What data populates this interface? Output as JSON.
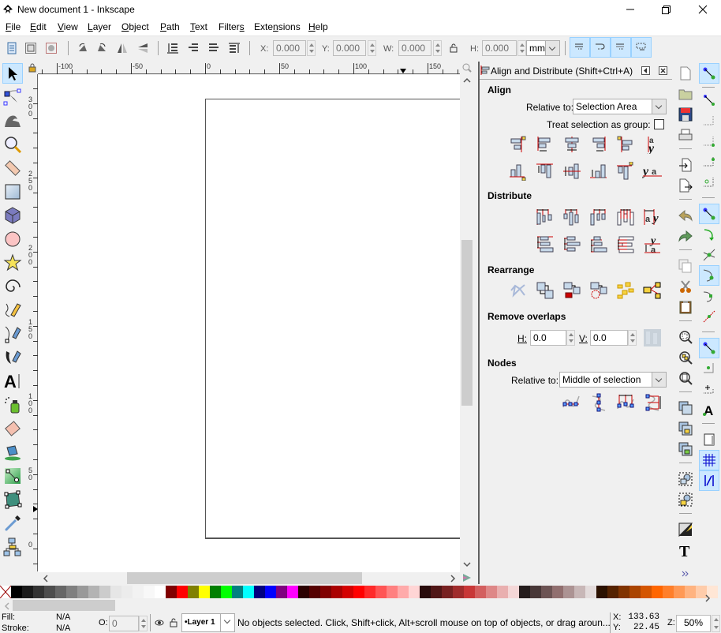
{
  "window": {
    "title": "New document 1 - Inkscape",
    "controls": [
      "minimize",
      "restore",
      "close"
    ]
  },
  "menu": [
    {
      "label": "File",
      "accel": "F"
    },
    {
      "label": "Edit",
      "accel": "E"
    },
    {
      "label": "View",
      "accel": "V"
    },
    {
      "label": "Layer",
      "accel": "L"
    },
    {
      "label": "Object",
      "accel": "O"
    },
    {
      "label": "Path",
      "accel": "P"
    },
    {
      "label": "Text",
      "accel": "T"
    },
    {
      "label": "Filters",
      "accel": "s"
    },
    {
      "label": "Extensions",
      "accel": "n"
    },
    {
      "label": "Help",
      "accel": "H"
    }
  ],
  "toolbar": {
    "x_label": "X:",
    "x_value": "0.000",
    "y_label": "Y:",
    "y_value": "0.000",
    "w_label": "W:",
    "w_value": "0.000",
    "h_label": "H:",
    "h_value": "0.000",
    "unit": "mm"
  },
  "rulers": {
    "horizontal": [
      "-100",
      "-50",
      "0",
      "50",
      "100",
      "150"
    ],
    "vertical": [
      "300",
      "250",
      "200",
      "150",
      "100",
      "50",
      "0"
    ]
  },
  "tools": [
    "selector",
    "node",
    "tweak",
    "zoom",
    "measure",
    "rectangle",
    "3d-box",
    "ellipse",
    "star",
    "spiral",
    "pencil",
    "pen",
    "calligraphy",
    "text",
    "spray",
    "eraser",
    "paint-bucket",
    "gradient",
    "mesh",
    "dropper",
    "connector"
  ],
  "align_panel": {
    "title": "Align and Distribute (Shift+Ctrl+A)",
    "align_heading": "Align",
    "relative_to_label": "Relative to:",
    "relative_to_value": "Selection Area",
    "treat_group_label": "Treat selection as group:",
    "treat_group_checked": false,
    "distribute_heading": "Distribute",
    "rearrange_heading": "Rearrange",
    "remove_overlaps_heading": "Remove overlaps",
    "h_label": "H:",
    "h_value": "0.0",
    "v_label": "V:",
    "v_value": "0.0",
    "nodes_heading": "Nodes",
    "nodes_relative_label": "Relative to:",
    "nodes_relative_value": "Middle of selection"
  },
  "palette": [
    "#000000",
    "#1a1a1a",
    "#333333",
    "#4d4d4d",
    "#666666",
    "#808080",
    "#999999",
    "#b3b3b3",
    "#cccccc",
    "#e6e6e6",
    "#ececec",
    "#f2f2f2",
    "#f8f8f8",
    "#ffffff",
    "#800000",
    "#ff0000",
    "#808000",
    "#ffff00",
    "#008000",
    "#00ff00",
    "#008080",
    "#00ffff",
    "#000080",
    "#0000ff",
    "#800080",
    "#ff00ff",
    "#2b0000",
    "#550000",
    "#800000",
    "#aa0000",
    "#d40000",
    "#ff0000",
    "#ff2a2a",
    "#ff5555",
    "#ff8080",
    "#ffaaaa",
    "#ffd5d5",
    "#280b0b",
    "#501616",
    "#782121",
    "#a02c2c",
    "#c83737",
    "#d35f5f",
    "#de8787",
    "#e9afaf",
    "#f4d7d7",
    "#241c1c",
    "#483737",
    "#6c5353",
    "#916f6f",
    "#ac9393",
    "#c8b7b7",
    "#e3dbdb",
    "#2b1100",
    "#552200",
    "#803300",
    "#aa4400",
    "#d45500",
    "#ff6600",
    "#ff7f2a",
    "#ff9955",
    "#ffb380",
    "#ffccaa",
    "#ffe6d5"
  ],
  "status": {
    "fill_label": "Fill:",
    "fill_value": "N/A",
    "stroke_label": "Stroke:",
    "stroke_value": "N/A",
    "opacity_label": "O:",
    "opacity_value": "0",
    "layer": "•Layer 1",
    "message": "No objects selected. Click, Shift+click, Alt+scroll mouse on top of objects, or drag aroun...",
    "x_label": "X:",
    "x_value": "133.63",
    "y_label": "Y:",
    "y_value": "22.45",
    "zoom_label": "Z:",
    "zoom_value": "50%"
  }
}
